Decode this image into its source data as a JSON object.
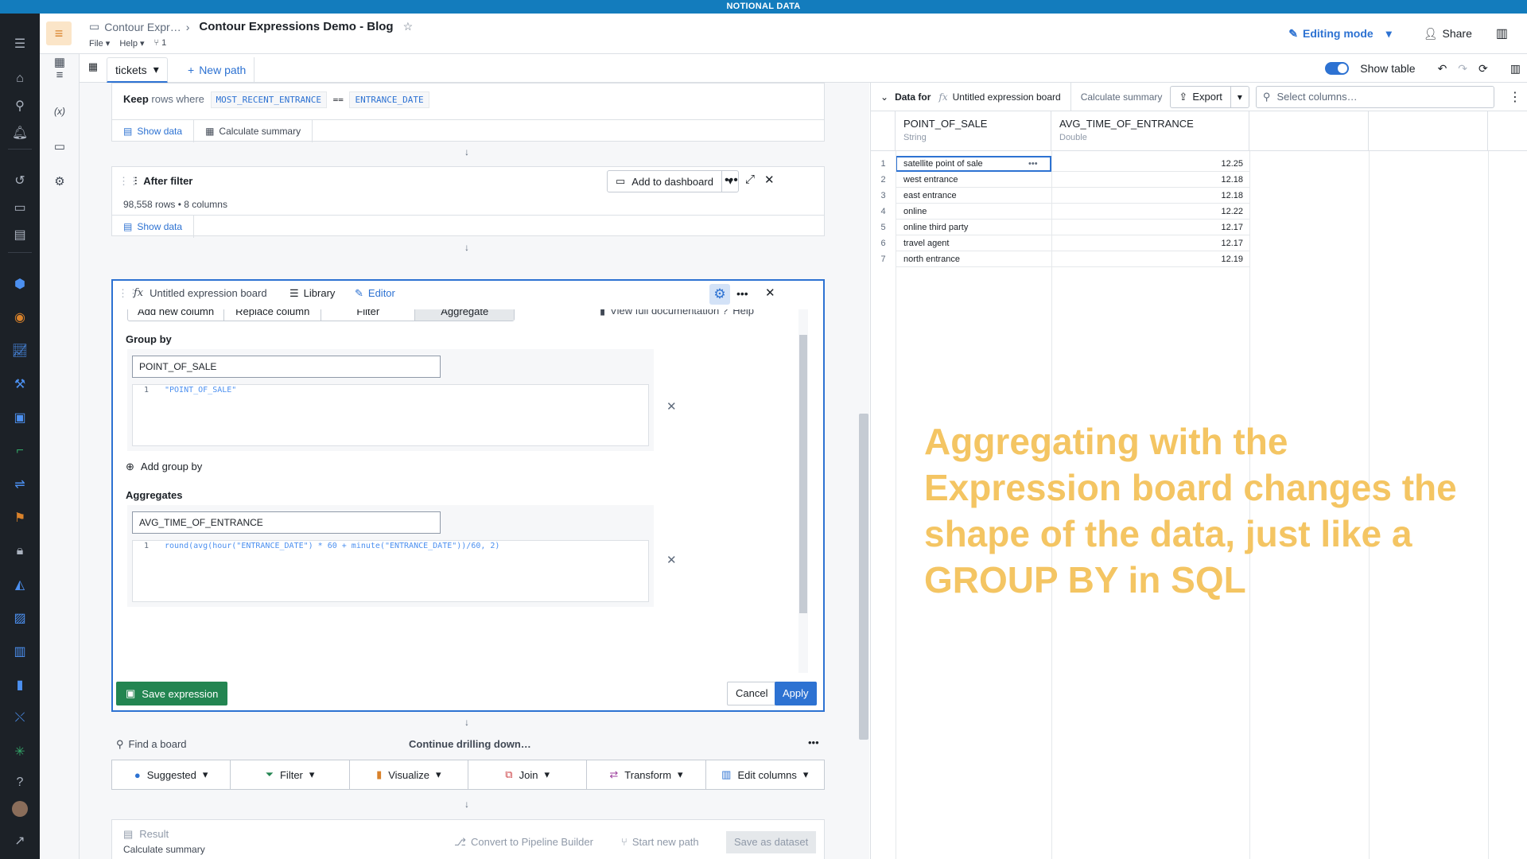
{
  "banner": "NOTIONAL DATA",
  "header": {
    "breadcrumb_parent": "Contour Expr…",
    "title": "Contour Expressions Demo - Blog",
    "menu_file": "File",
    "menu_help": "Help",
    "branch_count": "1",
    "editing_mode": "Editing mode",
    "share": "Share"
  },
  "toolbar": {
    "tab": "tickets",
    "new_path": "New path",
    "show_table": "Show table"
  },
  "boards": {
    "keep": {
      "keyword": "Keep",
      "text": "rows where",
      "left": "MOST_RECENT_ENTRANCE",
      "op": "==",
      "right": "ENTRANCE_DATE",
      "show_data": "Show data",
      "calc_summary": "Calculate summary"
    },
    "after_filter": {
      "title": "After filter",
      "add_dashboard": "Add to dashboard",
      "rows": "98,558 rows",
      "cols": "8 columns",
      "show_data": "Show data"
    },
    "expression": {
      "title": "Untitled expression board",
      "library": "Library",
      "editor": "Editor",
      "tabs": [
        "Add new column",
        "Replace column",
        "Filter",
        "Aggregate"
      ],
      "view_docs": "View full documentation",
      "help": "Help",
      "group_by_label": "Group by",
      "group_by_name": "POINT_OF_SALE",
      "group_by_code": "\"POINT_OF_SALE\"",
      "add_group_by": "Add group by",
      "aggregates_label": "Aggregates",
      "agg_name": "AVG_TIME_OF_ENTRANCE",
      "agg_code": "round(avg(hour(\"ENTRANCE_DATE\") * 60 + minute(\"ENTRANCE_DATE\"))/60, 2)",
      "line_no": "1",
      "save": "Save expression",
      "cancel": "Cancel",
      "apply": "Apply"
    },
    "drill": {
      "find": "Find a board",
      "continue": "Continue drilling down…",
      "buttons": [
        "Suggested",
        "Filter",
        "Visualize",
        "Join",
        "Transform",
        "Edit columns"
      ]
    },
    "result": {
      "title": "Result",
      "calc_summary": "Calculate summary",
      "convert": "Convert to Pipeline Builder",
      "start_path": "Start new path",
      "save_dataset": "Save as dataset"
    }
  },
  "right_panel": {
    "data_for": "Data for",
    "board_name": "Untitled expression board",
    "calc_summary": "Calculate summary",
    "export": "Export",
    "select_columns": "Select columns…",
    "columns": [
      {
        "name": "POINT_OF_SALE",
        "type": "String"
      },
      {
        "name": "AVG_TIME_OF_ENTRANCE",
        "type": "Double"
      }
    ],
    "rows": [
      {
        "n": "1",
        "pos": "satellite point of sale",
        "avg": "12.25"
      },
      {
        "n": "2",
        "pos": "west entrance",
        "avg": "12.18"
      },
      {
        "n": "3",
        "pos": "east entrance",
        "avg": "12.18"
      },
      {
        "n": "4",
        "pos": "online",
        "avg": "12.22"
      },
      {
        "n": "5",
        "pos": "online third party",
        "avg": "12.17"
      },
      {
        "n": "6",
        "pos": "travel agent",
        "avg": "12.17"
      },
      {
        "n": "7",
        "pos": "north entrance",
        "avg": "12.19"
      }
    ],
    "overlay": "Aggregating with the Expression board changes the shape of the data, just like a GROUP BY in SQL"
  },
  "colors": {
    "primary": "#2d72d2",
    "banner": "#137cbd",
    "save_green": "#238551",
    "overlay": "#f4c563"
  }
}
